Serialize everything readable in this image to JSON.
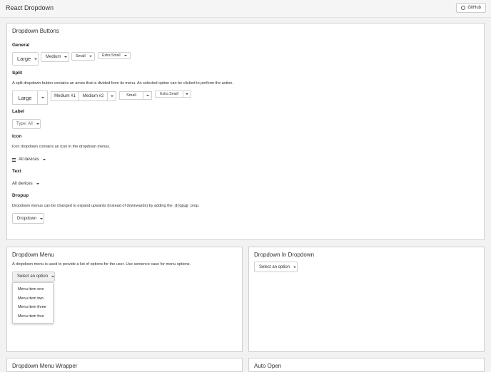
{
  "app": {
    "title": "React Dropdown",
    "github_label": "GitHub"
  },
  "buttons_panel": {
    "title": "Dropdown Buttons",
    "general": {
      "heading": "General",
      "buttons": [
        "Large",
        "Medium",
        "Small",
        "Extra Small"
      ]
    },
    "split": {
      "heading": "Split",
      "description": "A split dropdown button contains an arrow that is divided from its menu. An selected option can be clicked to perform the action.",
      "large": "Large",
      "medium_1": "Medium #1",
      "medium_2": "Medium #2",
      "small": "Small",
      "extra_small": "Extra Small"
    },
    "label": {
      "heading": "Label",
      "button": "Type: All"
    },
    "icon": {
      "heading": "Icon",
      "description": "Icon dropdown contains an icon in the dropdown menus.",
      "button": "All devices"
    },
    "text": {
      "heading": "Text",
      "button": "All devices"
    },
    "dropup": {
      "heading": "Dropup",
      "description_before": "Dropdown menus can be changed to expand upwards (instead of downwards) by adding the",
      "code": "dropup",
      "description_after": "prop.",
      "button": "Dropdown"
    }
  },
  "menu_panel": {
    "title": "Dropdown Menu",
    "description": "A dropdown menu is used to provide a list of options for the user. Use sentence case for menu options.",
    "button": "Select an option",
    "items": [
      "Menu item one",
      "Menu item two",
      "Menu item three",
      "Menu item four"
    ]
  },
  "nested_panel": {
    "title": "Dropdown In Dropdown",
    "button": "Select an option"
  },
  "bottom_panels": {
    "left_title": "Dropdown Menu Wrapper",
    "right_title": "Auto Open"
  }
}
